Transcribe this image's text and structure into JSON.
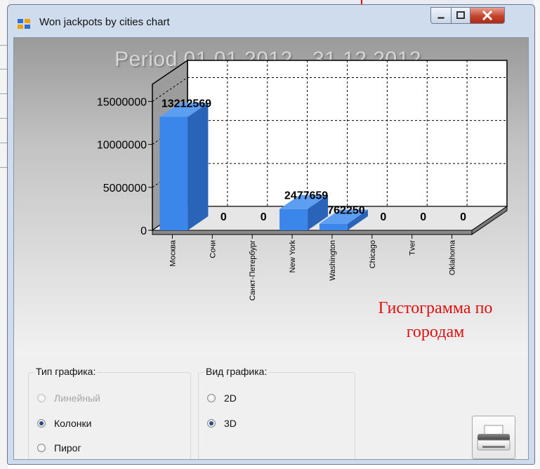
{
  "window": {
    "title": "Won jackpots by cities chart",
    "buttons": {
      "minimize": "minimize-icon",
      "maximize": "maximize-icon",
      "close": "close-icon"
    }
  },
  "chart_data": {
    "type": "bar",
    "title": "Period 01.01.2012 - 31.12.2012.",
    "categories": [
      "Москва",
      "Сочи",
      "Санкт-Петербург",
      "New York",
      "Washington",
      "Chicago",
      "Tver",
      "Oklahoma"
    ],
    "values": [
      13212569,
      0,
      0,
      2477659,
      762250,
      0,
      0,
      0
    ],
    "value_labels": [
      "13212569",
      "0",
      "0",
      "2477659",
      "762250",
      "0",
      "0",
      "0"
    ],
    "yticks": [
      0,
      5000000,
      10000000,
      15000000
    ],
    "ytick_labels": [
      "0",
      "5000000",
      "10000000",
      "15000000"
    ],
    "ylim": [
      0,
      17000000
    ],
    "grid": true,
    "style": "3d",
    "colors": {
      "bar": "#3a86ea",
      "bar_side": "#2a64b8",
      "bar_top": "#5b9ef2",
      "grid": "#000000"
    }
  },
  "annotation": {
    "line1": "Гистограмма по",
    "line2": "городам",
    "color": "#e01010"
  },
  "chart_type_group": {
    "legend": "Тип графика:",
    "options": [
      {
        "label": "Линейный",
        "checked": false,
        "enabled": false
      },
      {
        "label": "Колонки",
        "checked": true,
        "enabled": true
      },
      {
        "label": "Пирог",
        "checked": false,
        "enabled": true
      }
    ]
  },
  "chart_view_group": {
    "legend": "Вид графика:",
    "options": [
      {
        "label": "2D",
        "checked": false,
        "enabled": true
      },
      {
        "label": "3D",
        "checked": true,
        "enabled": true
      }
    ]
  },
  "print_button": {
    "icon": "printer-icon"
  }
}
